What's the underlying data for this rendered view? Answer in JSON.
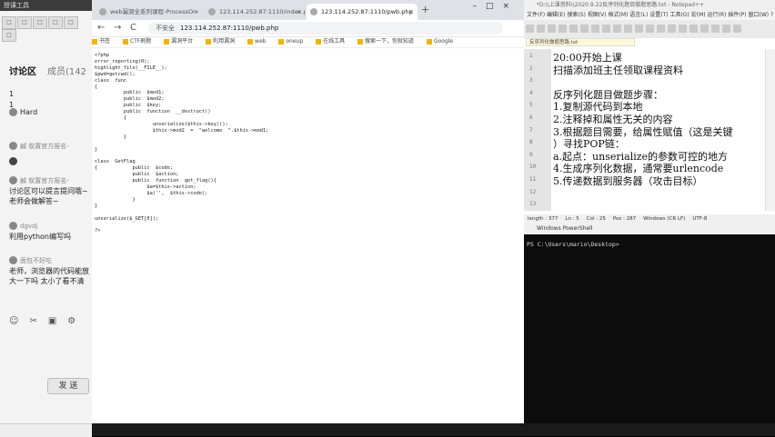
{
  "chat": {
    "window_title": "授课工具",
    "tool_labels": [
      "□",
      "□",
      "□",
      "□",
      "□",
      "□"
    ],
    "tab_discussion": "讨论区",
    "tab_members": "成员(142",
    "messages": [
      {
        "text": "1"
      },
      {
        "text": "1"
      },
      {
        "user": "Hard"
      },
      {
        "user": "鹹 蚁置官方报名-",
        "text": " "
      },
      {
        "user": "鹹 蚁置官方报名-",
        "text": "讨论区可以提言提问哦~老师会做解答~"
      },
      {
        "user": "dgvdj",
        "text": "利用python编写吗"
      },
      {
        "user": "面包不好吃",
        "text": "老师，浏览器的代码能放大一下吗 太小了看不清"
      }
    ],
    "bottom_tools": [
      "☺",
      "✂",
      "▣",
      "⚙"
    ],
    "send_label": "发 送"
  },
  "browser": {
    "tabs": [
      {
        "label": "web漏洞全系列课程-ProcessOn"
      },
      {
        "label": "123.114.252.87:1110/index.ph"
      },
      {
        "label": "123.114.252.87:1110/pwb.php",
        "active": true
      }
    ],
    "nav": {
      "back": "←",
      "forward": "→",
      "reload": "C"
    },
    "url_insecure": "不安全",
    "url": "123.114.252.87:1110/pwb.php",
    "bookmarks": [
      "书签",
      "CTF刷题",
      "漏洞平台",
      "利用漏洞",
      "web",
      "oneup",
      "在线工具",
      "搜索一下，你就知道",
      "Google"
    ],
    "code_lines": [
      "<?php",
      "error_reporting(0);",
      "highlight_file(__FILE__);",
      "$pwd=getcwd();",
      "class  func",
      "{",
      "          public  $mod1;",
      "          public  $mod2;",
      "          public  $key;",
      "          public  function  __destruct()",
      "          {",
      "                    unserialize($this->key)();",
      "                    $this->mod2  =  \"welcome  \".$this->mod1;",
      "          }",
      "",
      "}",
      "",
      "class  GetFlag",
      "{            public  $code;",
      "             public  $action;",
      "             public  function  get_flag(){",
      "                  $a=$this->action;",
      "                  $a('',  $this->code);",
      "             }",
      "}",
      "",
      "unserialize($_GET[0]);",
      "",
      "?>"
    ]
  },
  "npp": {
    "title": "*D:\\\\上课资料\\\\2020.9.22反序列化题目做题思路.txt - Notepad++",
    "menu": "文件(F)  编辑(E)  搜索(S)  视图(V)  格式(M)  语言(L)  设置(T)  工具(O)  宏(M)  运行(R)  插件(P)  窗口(W)  ?",
    "file_tab": "反序列化做题思路.txt",
    "line_numbers": [
      "1",
      "2",
      "3",
      "4",
      "5",
      "6",
      "7",
      "8",
      "9",
      "10",
      "11",
      "12",
      "13"
    ],
    "lines": [
      "20:00开始上课",
      "扫描添加班主任领取课程资料",
      "",
      "反序列化题目做题步骤：",
      "1.复制源代码到本地",
      "2.注释掉和属性无关的内容",
      "3.根据题目需要，给属性赋值（这是关键",
      "）寻找POP链：",
      "a.起点：unserialize的参数可控的地方",
      "4.生成序列化数据，通常要urlencode",
      "5.传递数据到服务器（攻击目标）",
      "",
      ""
    ],
    "status": [
      "length : 377",
      "Ln : 5",
      "Col : 25",
      "Pos : 287",
      "Windows (CR LF)",
      "UTF-8"
    ]
  },
  "powershell": {
    "title": "Windows PowerShell",
    "prompt": "PS C:\\Users\\mario\\Desktop>"
  }
}
